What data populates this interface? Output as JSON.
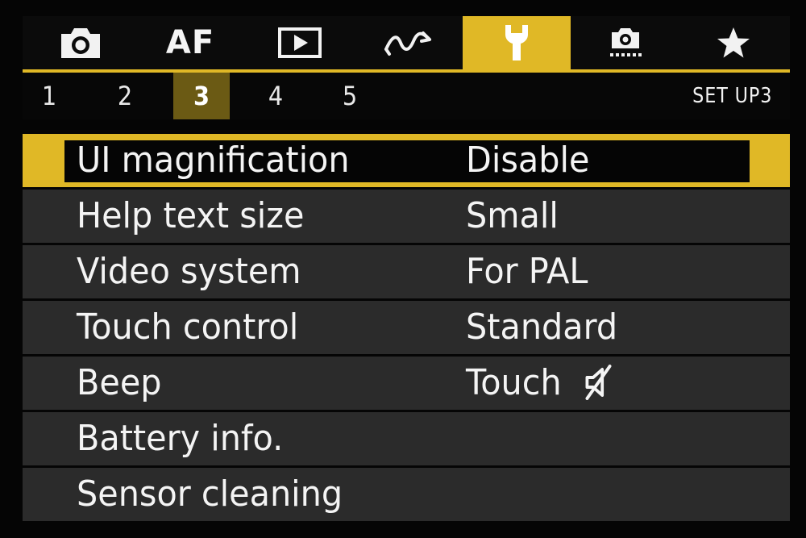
{
  "tabs": [
    {
      "icon": "camera-icon",
      "active": false
    },
    {
      "label": "AF",
      "active": false
    },
    {
      "icon": "playback-icon",
      "active": false
    },
    {
      "icon": "wireless-icon",
      "active": false
    },
    {
      "icon": "wrench-icon",
      "active": true
    },
    {
      "icon": "custom-functions-icon",
      "active": false
    },
    {
      "icon": "star-icon",
      "active": false
    }
  ],
  "subtabs": [
    "1",
    "2",
    "3",
    "4",
    "5"
  ],
  "active_subtab": "3",
  "page_label": "SET UP3",
  "menu": [
    {
      "name": "UI magnification",
      "value": "Disable",
      "selected": true
    },
    {
      "name": "Help text size",
      "value": "Small"
    },
    {
      "name": "Video system",
      "value": "For PAL"
    },
    {
      "name": "Touch control",
      "value": "Standard"
    },
    {
      "name": "Beep",
      "value": "Touch",
      "value_icon": "speaker-mute-icon"
    },
    {
      "name": "Battery info.",
      "value": ""
    },
    {
      "name": "Sensor cleaning",
      "value": ""
    }
  ],
  "colors": {
    "accent": "#e0b826",
    "row_bg": "#2b2b2b",
    "subtab_active": "#6b5a14"
  }
}
